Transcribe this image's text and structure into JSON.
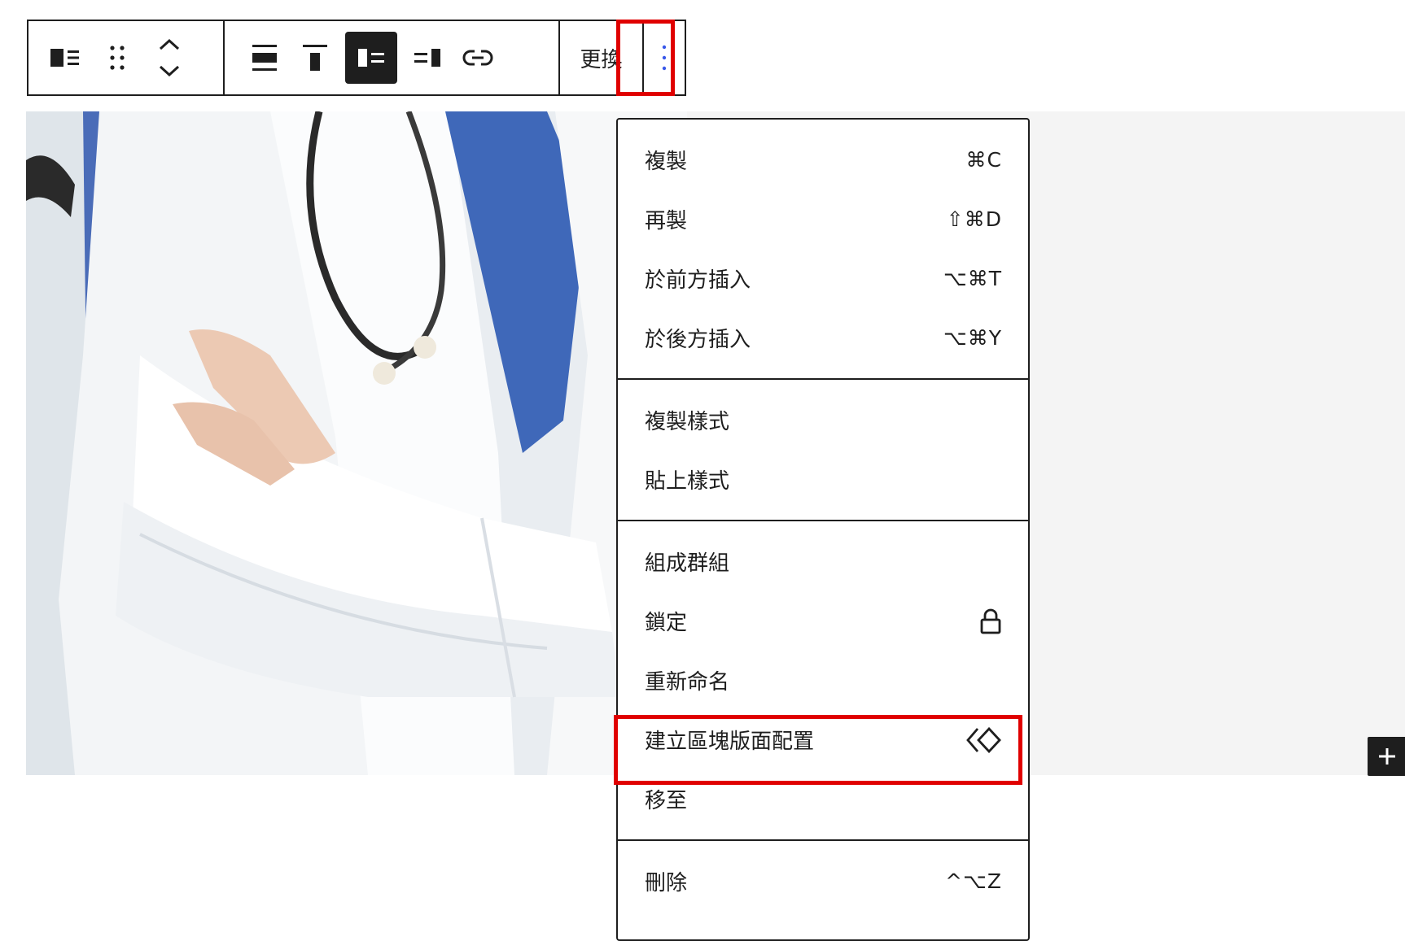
{
  "toolbar": {
    "replace_label": "更換"
  },
  "menu": {
    "sections": [
      {
        "items": [
          {
            "label": "複製",
            "shortcut": "⌘C"
          },
          {
            "label": "再製",
            "shortcut": "⇧⌘D"
          },
          {
            "label": "於前方插入",
            "shortcut": "⌥⌘T"
          },
          {
            "label": "於後方插入",
            "shortcut": "⌥⌘Y"
          }
        ]
      },
      {
        "items": [
          {
            "label": "複製樣式"
          },
          {
            "label": "貼上樣式"
          }
        ]
      },
      {
        "items": [
          {
            "label": "組成群組"
          },
          {
            "label": "鎖定",
            "icon": "lock-icon"
          },
          {
            "label": "重新命名"
          },
          {
            "label": "建立區塊版面配置",
            "icon": "pattern-icon"
          },
          {
            "label": "移至"
          }
        ]
      },
      {
        "items": [
          {
            "label": "刪除",
            "shortcut": "^⌥Z"
          }
        ]
      }
    ]
  },
  "colors": {
    "highlight": "#e00000",
    "dark": "#1e1e1e",
    "accent": "#3858e9",
    "canvas": "#f4f4f4"
  }
}
